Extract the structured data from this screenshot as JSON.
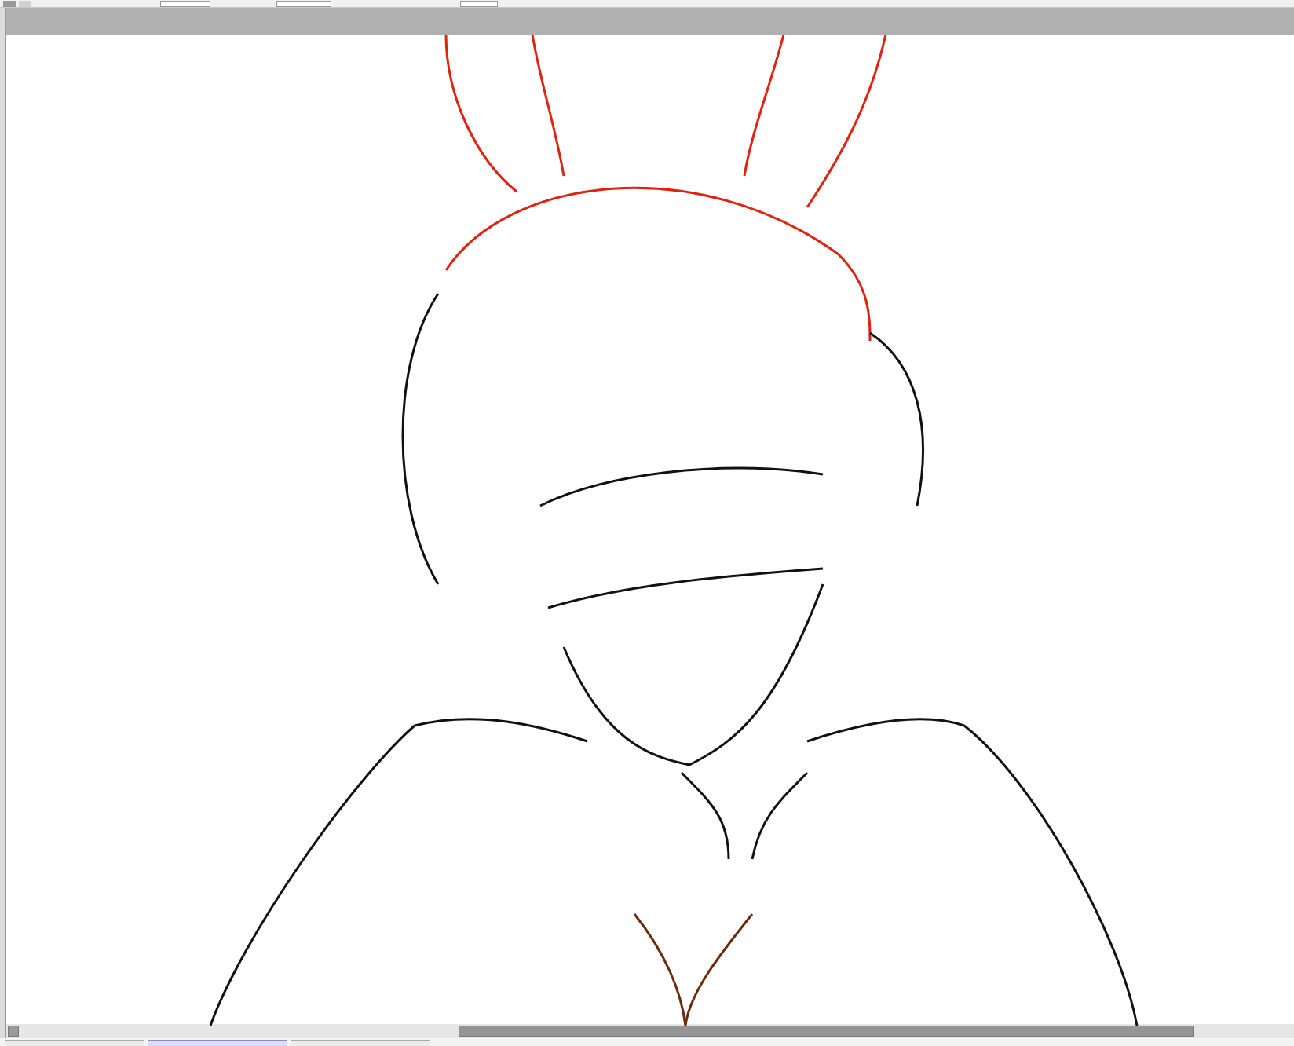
{
  "document_tabs": [
    {
      "selected": false
    },
    {
      "selected": true
    },
    {
      "selected": false
    }
  ]
}
